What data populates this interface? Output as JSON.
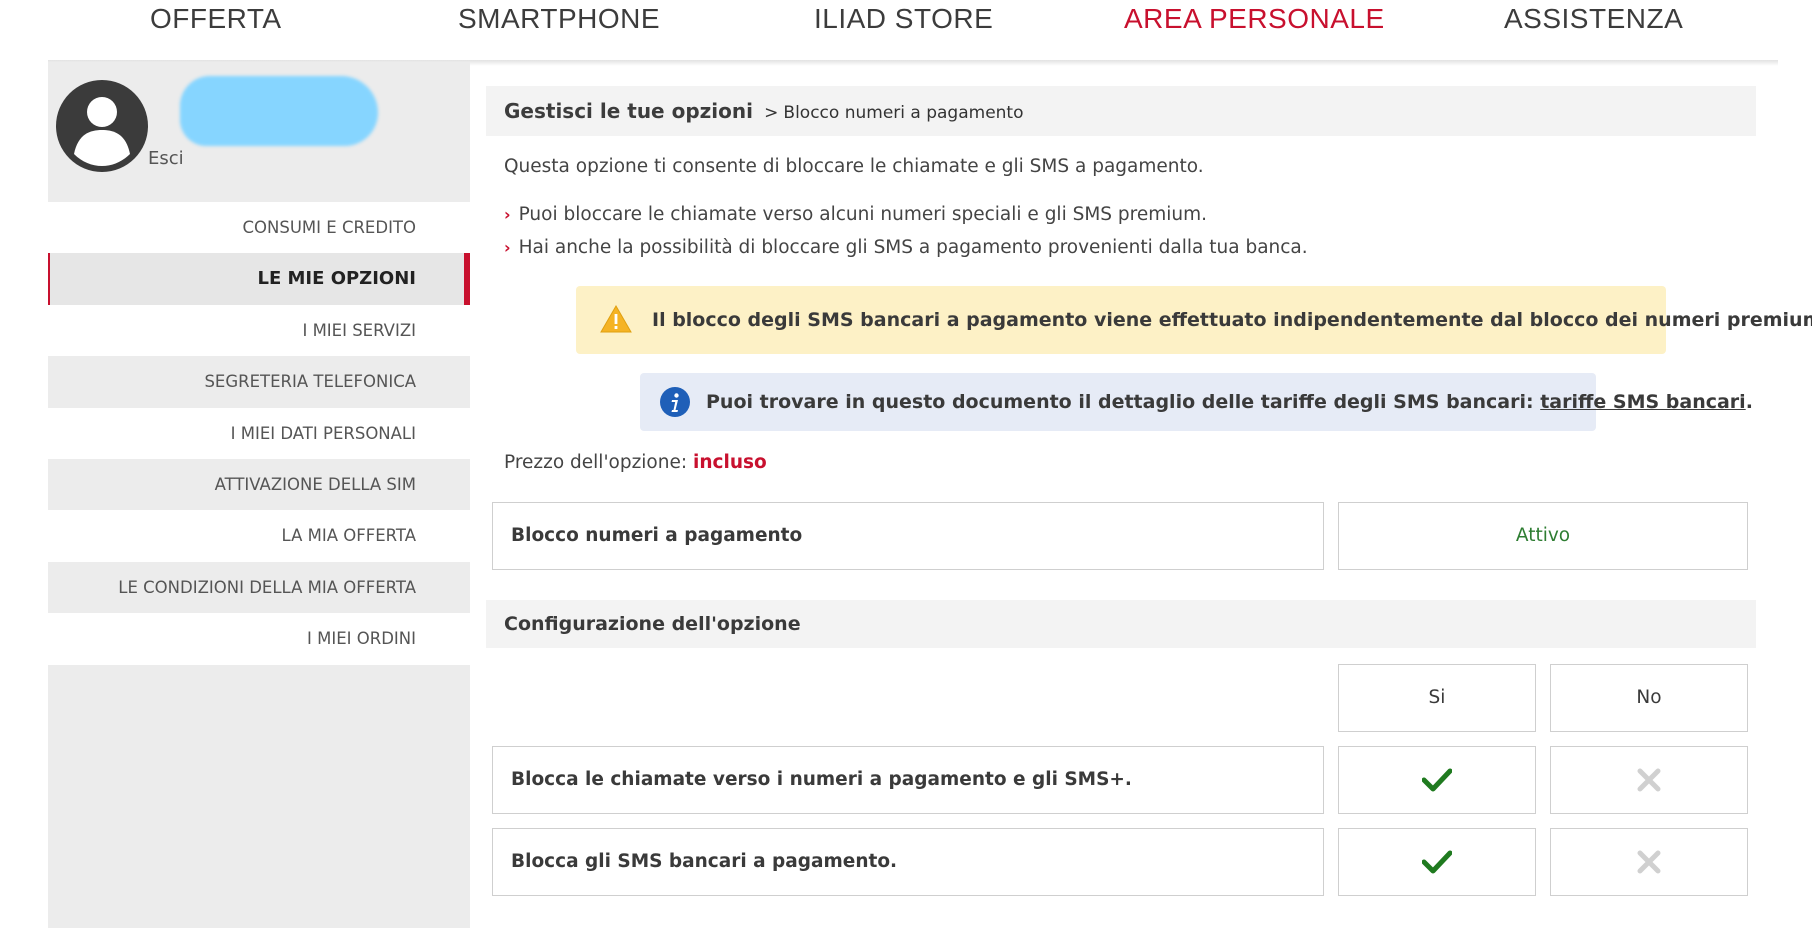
{
  "nav": {
    "items": [
      {
        "label": "OFFERTA",
        "active": false
      },
      {
        "label": "SMARTPHONE",
        "active": false
      },
      {
        "label": "ILIAD STORE",
        "active": false
      },
      {
        "label": "AREA PERSONALE",
        "active": true
      },
      {
        "label": "ASSISTENZA",
        "active": false
      }
    ]
  },
  "sidebar": {
    "logout_label": "Esci",
    "items": [
      {
        "label": "CONSUMI E CREDITO",
        "active": false
      },
      {
        "label": "LE MIE OPZIONI",
        "active": true
      },
      {
        "label": "I MIEI SERVIZI",
        "active": false
      },
      {
        "label": "SEGRETERIA TELEFONICA",
        "active": false
      },
      {
        "label": "I MIEI DATI PERSONALI",
        "active": false
      },
      {
        "label": "ATTIVAZIONE DELLA SIM",
        "active": false
      },
      {
        "label": "LA MIA OFFERTA",
        "active": false
      },
      {
        "label": "LE CONDIZIONI DELLA MIA OFFERTA",
        "active": false
      },
      {
        "label": "I MIEI ORDINI",
        "active": false
      }
    ]
  },
  "breadcrumb": {
    "main": "Gestisci le tue opzioni",
    "separator": ">",
    "sub": "Blocco numeri a pagamento"
  },
  "content": {
    "intro": "Questa opzione ti consente di bloccare le chiamate e gli SMS a pagamento.",
    "bullets": [
      "Puoi bloccare le chiamate verso alcuni numeri speciali e gli SMS premium.",
      "Hai anche la possibilità di bloccare gli SMS a pagamento provenienti dalla tua banca."
    ],
    "warning": "Il blocco degli SMS bancari a pagamento viene effettuato indipendentemente dal blocco dei numeri premium.",
    "info_text": "Puoi trovare in questo documento il dettaglio delle tariffe degli SMS bancari:",
    "info_link": "tariffe SMS bancari",
    "info_end": ".",
    "price_label": "Prezzo dell'opzione:",
    "price_value": "incluso"
  },
  "option": {
    "name": "Blocco numeri a pagamento",
    "status": "Attivo"
  },
  "config": {
    "title": "Configurazione dell'opzione",
    "col_yes": "Si",
    "col_no": "No",
    "rows": [
      {
        "label": "Blocca le chiamate verso i numeri a pagamento e gli SMS+.",
        "selected": "Si"
      },
      {
        "label": "Blocca gli SMS bancari a pagamento.",
        "selected": "Si"
      }
    ]
  },
  "colors": {
    "brand_red": "#c8102e",
    "check_green": "#1f7a1f",
    "cross_gray": "#d0d0d0",
    "warning_bg": "#fdf1c6",
    "info_bg": "#e6ebf6"
  }
}
